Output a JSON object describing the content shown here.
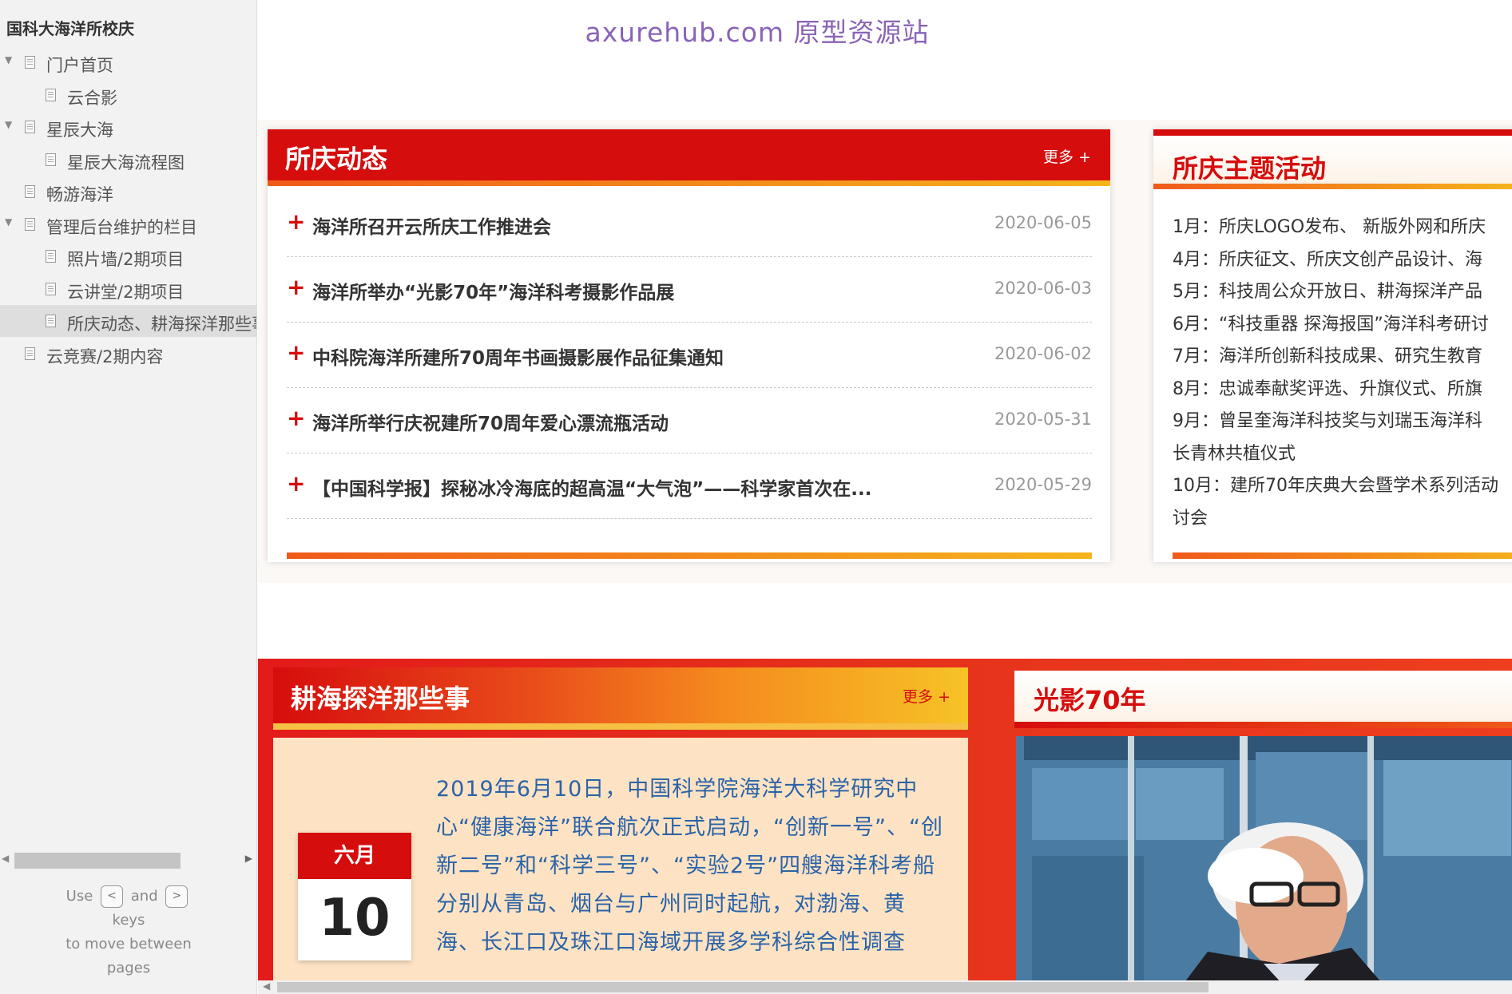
{
  "sidebar": {
    "project_title": "国科大海洋所校庆",
    "items": [
      {
        "label": "门户首页",
        "level": 0,
        "expanded": true,
        "selected": false
      },
      {
        "label": "云合影",
        "level": 1,
        "expanded": false,
        "selected": false
      },
      {
        "label": "星辰大海",
        "level": 0,
        "expanded": true,
        "selected": false
      },
      {
        "label": "星辰大海流程图",
        "level": 1,
        "expanded": false,
        "selected": false
      },
      {
        "label": "畅游海洋",
        "level": 0,
        "expanded": false,
        "selected": false
      },
      {
        "label": "管理后台维护的栏目",
        "level": 0,
        "expanded": true,
        "selected": false
      },
      {
        "label": "照片墙/2期项目",
        "level": 1,
        "expanded": false,
        "selected": false
      },
      {
        "label": "云讲堂/2期项目",
        "level": 1,
        "expanded": false,
        "selected": false
      },
      {
        "label": "所庆动态、耕海探洋那些事",
        "level": 1,
        "expanded": false,
        "selected": true
      },
      {
        "label": "云竞赛/2期内容",
        "level": 0,
        "expanded": false,
        "selected": false
      }
    ],
    "hint": {
      "use": "Use",
      "key_prev": "<",
      "and": "and",
      "key_next": ">",
      "keys": "keys",
      "line2": "to move between",
      "line3": "pages"
    }
  },
  "main": {
    "watermark": "axurehub.com 原型资源站",
    "news": {
      "title": "所庆动态",
      "more": "更多 +",
      "items": [
        {
          "title": "海洋所召开云所庆工作推进会",
          "date": "2020-06-05"
        },
        {
          "title": "海洋所举办“光影70年”海洋科考摄影作品展",
          "date": "2020-06-03"
        },
        {
          "title": "中科院海洋所建所70周年书画摄影展作品征集通知",
          "date": "2020-06-02"
        },
        {
          "title": "海洋所举行庆祝建所70周年爱心漂流瓶活动",
          "date": "2020-05-31"
        },
        {
          "title": "【中国科学报】探秘冰冷海底的超高温“大气泡”——科学家首次在...",
          "date": "2020-05-29"
        }
      ]
    },
    "activities": {
      "title": "所庆主题活动",
      "lines": [
        "1月：所庆LOGO发布、 新版外网和所庆",
        "4月：所庆征文、所庆文创产品设计、海",
        "5月：科技周公众开放日、耕海探洋产品",
        "6月：“科技重器 探海报国”海洋科考研讨",
        "7月：海洋所创新科技成果、研究生教育",
        "8月：忠诚奉献奖评选、升旗仪式、所旗",
        "9月：曾呈奎海洋科技奖与刘瑞玉海洋科",
        "长青林共植仪式",
        "10月：建所70年庆典大会暨学术系列活动",
        "讨会"
      ]
    },
    "sea": {
      "title": "耕海探洋那些事",
      "more": "更多 +",
      "calendar_month": "六月",
      "calendar_day": "10",
      "story": "2019年6月10日，中国科学院海洋大科学研究中心“健康海洋”联合航次正式启动，“创新一号”、“创新二号”和“科学三号”、“实验2号”四艘海洋科考船分别从青岛、烟台与广州同时起航，对渤海、黄海、长江口及珠江口海域开展多学科综合性调查"
    },
    "photo": {
      "title": "光影70年"
    }
  },
  "colors": {
    "brand_red": "#d60d0d",
    "accent_orange": "#f05a1a",
    "accent_yellow": "#f5b51c",
    "story_blue": "#2b63a8",
    "watermark_purple": "#8a63b8"
  }
}
